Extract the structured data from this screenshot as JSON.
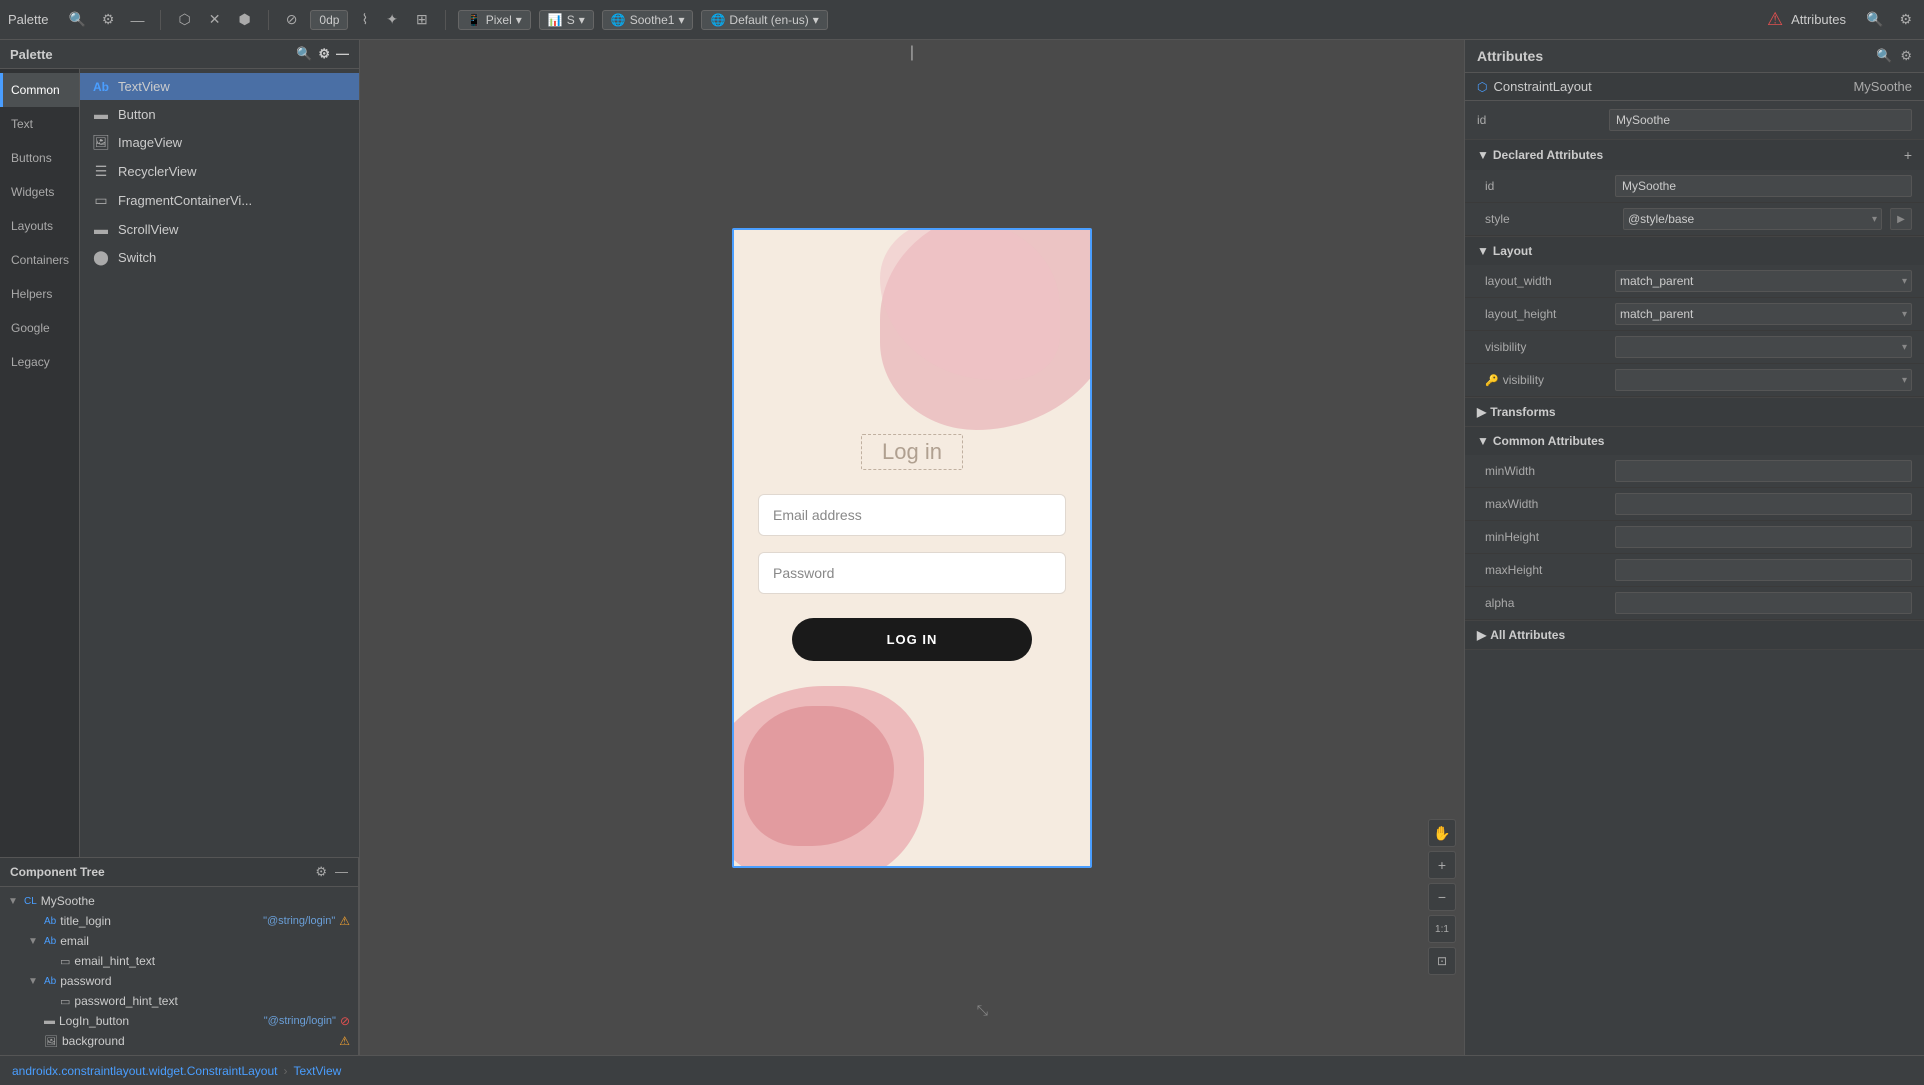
{
  "toolbar": {
    "palette_label": "Palette",
    "attributes_label": "Attributes",
    "device": "Pixel",
    "theme": "Soothe1",
    "locale": "Default (en-us)",
    "zoom": "0dp",
    "search_icon": "🔍",
    "settings_icon": "⚙",
    "minimize_icon": "—"
  },
  "palette": {
    "title": "Palette",
    "categories": [
      {
        "id": "common",
        "label": "Common",
        "active": true
      },
      {
        "id": "text",
        "label": "Text",
        "active": false
      },
      {
        "id": "buttons",
        "label": "Buttons",
        "active": false
      },
      {
        "id": "widgets",
        "label": "Widgets",
        "active": false
      },
      {
        "id": "layouts",
        "label": "Layouts",
        "active": false
      },
      {
        "id": "containers",
        "label": "Containers",
        "active": false
      },
      {
        "id": "helpers",
        "label": "Helpers",
        "active": false
      },
      {
        "id": "google",
        "label": "Google",
        "active": false
      },
      {
        "id": "legacy",
        "label": "Legacy",
        "active": false
      }
    ],
    "items": [
      {
        "id": "textview",
        "label": "TextView",
        "icon": "Ab",
        "type": "text",
        "selected": true
      },
      {
        "id": "button",
        "label": "Button",
        "icon": "▬",
        "type": "shape"
      },
      {
        "id": "imageview",
        "label": "ImageView",
        "icon": "🖼",
        "type": "image"
      },
      {
        "id": "recyclerview",
        "label": "RecyclerView",
        "icon": "☰",
        "type": "list"
      },
      {
        "id": "fragmentcontainer",
        "label": "FragmentContainerVi...",
        "icon": "▭",
        "type": "shape"
      },
      {
        "id": "scrollview",
        "label": "ScrollView",
        "icon": "▬",
        "type": "shape"
      },
      {
        "id": "switch",
        "label": "Switch",
        "icon": "⬤",
        "type": "toggle"
      }
    ]
  },
  "canvas": {
    "phone": {
      "title": "Log in",
      "email_placeholder": "Email address",
      "password_placeholder": "Password",
      "login_button": "LOG IN"
    }
  },
  "component_tree": {
    "title": "Component Tree",
    "items": [
      {
        "id": "mysoothe",
        "label": "MySoothe",
        "indent": 0,
        "icon": "CL",
        "expandable": true,
        "expanded": true
      },
      {
        "id": "title_login",
        "label": "title_login",
        "sublabel": "\"@string/login\"",
        "indent": 1,
        "icon": "Ab",
        "warning": true
      },
      {
        "id": "email",
        "label": "email",
        "indent": 1,
        "icon": "Ab",
        "expandable": true,
        "expanded": true
      },
      {
        "id": "email_hint_text",
        "label": "email_hint_text",
        "indent": 2,
        "icon": "▭"
      },
      {
        "id": "password",
        "label": "password",
        "indent": 1,
        "icon": "Ab",
        "expandable": true,
        "expanded": true
      },
      {
        "id": "password_hint_text",
        "label": "password_hint_text",
        "indent": 2,
        "icon": "▭"
      },
      {
        "id": "login_button",
        "label": "LogIn_button",
        "sublabel": "\"@string/login\"",
        "indent": 1,
        "icon": "▬",
        "error": true
      },
      {
        "id": "background",
        "label": "background",
        "indent": 1,
        "icon": "🖼",
        "warning": true
      }
    ]
  },
  "attributes": {
    "title": "Attributes",
    "component_type": "ConstraintLayout",
    "component_id": "MySoothe",
    "id_label": "id",
    "id_value": "MySoothe",
    "sections": {
      "declared": {
        "title": "Declared Attributes",
        "rows": [
          {
            "key": "id",
            "value": "MySoothe",
            "type": "input"
          },
          {
            "key": "style",
            "value": "@style/base",
            "type": "dropdown"
          }
        ]
      },
      "layout": {
        "title": "Layout",
        "rows": [
          {
            "key": "layout_width",
            "value": "match_parent",
            "type": "dropdown"
          },
          {
            "key": "layout_height",
            "value": "match_parent",
            "type": "dropdown"
          },
          {
            "key": "visibility",
            "value": "",
            "type": "dropdown"
          },
          {
            "key": "visibility",
            "value": "",
            "type": "dropdown",
            "has_icon": true
          }
        ]
      },
      "transforms": {
        "title": "Transforms",
        "rows": []
      },
      "common": {
        "title": "Common Attributes",
        "rows": [
          {
            "key": "minWidth",
            "value": "",
            "type": "input"
          },
          {
            "key": "maxWidth",
            "value": "",
            "type": "input"
          },
          {
            "key": "minHeight",
            "value": "",
            "type": "input"
          },
          {
            "key": "maxHeight",
            "value": "",
            "type": "input"
          },
          {
            "key": "alpha",
            "value": "",
            "type": "input"
          }
        ]
      },
      "all": {
        "title": "All Attributes",
        "collapsed": true
      }
    }
  },
  "status_bar": {
    "breadcrumb1": "androidx.constraintlayout.widget.ConstraintLayout",
    "separator": "›",
    "breadcrumb2": "TextView"
  }
}
